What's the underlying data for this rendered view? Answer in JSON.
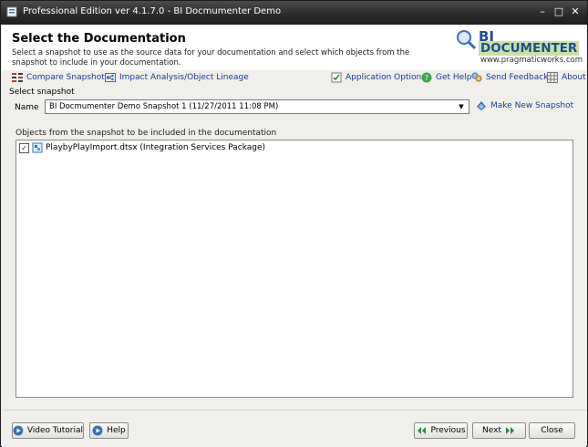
{
  "window": {
    "title": "Professional Edition ver 4.1.7.0 - BI Docmumenter Demo",
    "controls": [
      "–",
      "□",
      "✕"
    ]
  },
  "header": {
    "title": "Select the Documentation",
    "description": "Select a snapshot to use as the source data for your documentation and select which objects from the snapshot to include in your documentation.",
    "logo": {
      "line1": "BI",
      "line2": "DOCUMENTER",
      "site": "www.pragmaticworks.com"
    }
  },
  "toolbar": {
    "compare_snapshots": "Compare Snapshots",
    "impact_analysis": "Impact Analysis/Object Lineage",
    "application_options": "Application Options",
    "get_help": "Get Help",
    "send_feedback": "Send Feedback",
    "about": "About"
  },
  "snapshot": {
    "group_label": "Select snapshot",
    "name_label": "Name",
    "selected": "BI Docmumenter Demo Snapshot 1 (11/27/2011 11:08 PM)",
    "make_new": "Make New Snapshot"
  },
  "objects": {
    "label": "Objects from the snapshot to be included in the documentation",
    "items": [
      {
        "label": "PlaybyPlayImport.dtsx (Integration Services Package)",
        "checked": true
      }
    ]
  },
  "footer": {
    "video_tutorial": "Video Tutorial",
    "help": "Help",
    "previous": "Previous",
    "next": "Next",
    "close": "Close"
  },
  "colors": {
    "link": "#1a3c8f",
    "titlebar": "#2b2b2b",
    "logo_blue": "#1e4e8c",
    "logo_green": "#c9e0a8"
  }
}
